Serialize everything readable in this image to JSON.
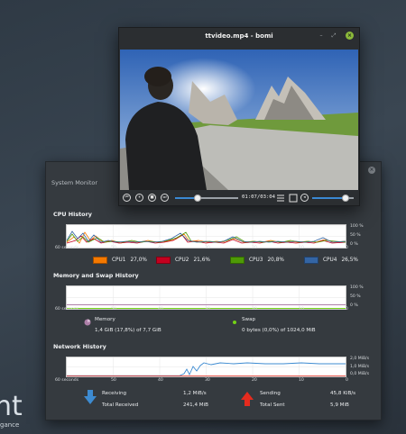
{
  "desktop": {
    "logo_text": "nt",
    "logo_tagline": "gance"
  },
  "video_window": {
    "title": "ttvideo.mp4 - bomi",
    "minimize_icon": "minimize-icon",
    "maximize_icon": "maximize-icon",
    "close_icon": "close-icon",
    "controls": {
      "timecode": "01:07/03:04",
      "seek_progress": 0.36,
      "volume_level": 0.8,
      "buttons": [
        "previous-icon",
        "pause-icon",
        "stop-icon",
        "next-icon",
        "playlist-icon",
        "fullscreen-icon",
        "volume-icon"
      ]
    }
  },
  "system_monitor": {
    "title": "System Monitor",
    "close_icon": "close-icon",
    "time_axis": [
      "60 seconds",
      "50",
      "40",
      "30",
      "20",
      "10",
      "0"
    ],
    "cpu": {
      "title": "CPU History",
      "y_axis": [
        "100 %",
        "50 %",
        "0 %"
      ],
      "cores": [
        {
          "label": "CPU1",
          "value": "27,0%",
          "color": "#f57900"
        },
        {
          "label": "CPU2",
          "value": "21,6%",
          "color": "#c4001f"
        },
        {
          "label": "CPU3",
          "value": "20,8%",
          "color": "#4e9a06"
        },
        {
          "label": "CPU4",
          "value": "26,5%",
          "color": "#3465a4"
        }
      ]
    },
    "memory": {
      "title": "Memory and Swap History",
      "y_axis": [
        "100 %",
        "50 %",
        "0 %"
      ],
      "memory_label": "Memory",
      "memory_value": "1,4 GiB (17,8%) of 7,7 GiB",
      "swap_label": "Swap",
      "swap_value": "0 bytes (0,0%) of 1024,0 MiB",
      "memory_color": "#ad7fa8",
      "swap_color": "#73d216"
    },
    "network": {
      "title": "Network History",
      "y_axis": [
        "2,0 MiB/s",
        "1,0 MiB/s",
        "0,0 MiB/s"
      ],
      "receiving_label": "Receiving",
      "receiving_value": "1,2 MiB/s",
      "total_received_label": "Total Received",
      "total_received_value": "241,4 MiB",
      "sending_label": "Sending",
      "sending_value": "45,8 KiB/s",
      "total_sent_label": "Total Sent",
      "total_sent_value": "5,9 MiB",
      "receiving_color": "#3d8bd1",
      "sending_color": "#e52b1e"
    }
  }
}
